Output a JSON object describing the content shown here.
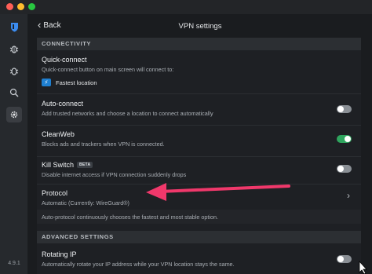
{
  "window": {
    "controls": [
      "close",
      "minimize",
      "zoom"
    ]
  },
  "rail": {
    "icons": [
      "shield-logo-icon",
      "bug-icon",
      "bug-icon",
      "search-bug-icon",
      "gear-icon"
    ],
    "version": "4.9.1"
  },
  "header": {
    "back_label": "Back",
    "title": "VPN settings"
  },
  "connectivity": {
    "heading": "CONNECTIVITY",
    "quick_connect": {
      "title": "Quick-connect",
      "desc": "Quick-connect button on main screen will connect to:",
      "option": "Fastest location"
    },
    "auto_connect": {
      "title": "Auto-connect",
      "desc": "Add trusted networks and choose a location to connect automatically",
      "enabled": false
    },
    "cleanweb": {
      "title": "CleanWeb",
      "desc": "Blocks ads and trackers when VPN is connected.",
      "enabled": true
    },
    "kill_switch": {
      "title": "Kill Switch",
      "badge": "BETA",
      "desc": "Disable internet access if VPN connection suddenly drops",
      "enabled": false
    },
    "protocol": {
      "title": "Protocol",
      "desc": "Automatic (Currently: WireGuard®)",
      "note": "Auto-protocol continuously chooses the fastest and most stable option."
    }
  },
  "advanced": {
    "heading": "ADVANCED SETTINGS",
    "rotating_ip": {
      "title": "Rotating IP",
      "desc": "Automatically rotate your IP address while your VPN location stays the same.",
      "enabled": false
    }
  },
  "colors": {
    "toggle_on": "#2fa55e",
    "toggle_off": "#8a8f95",
    "accent_blue": "#1f7fd0",
    "annotation_arrow": "#f0386b"
  }
}
